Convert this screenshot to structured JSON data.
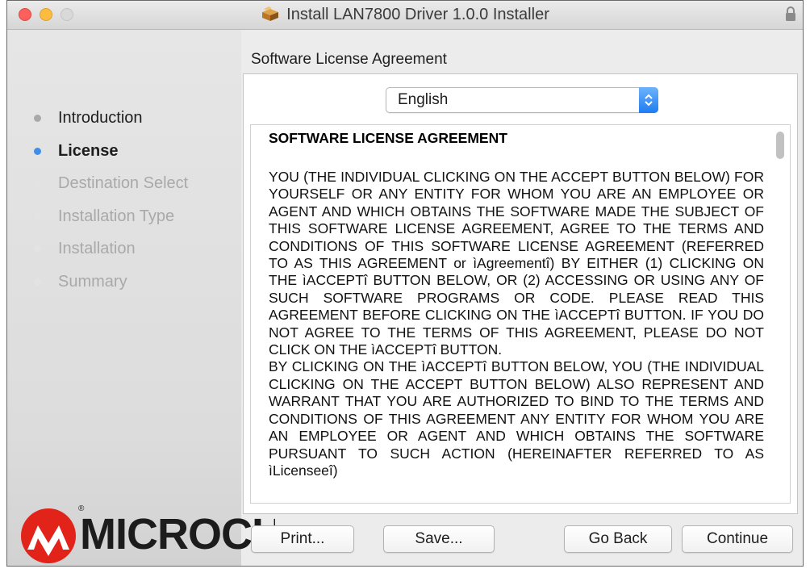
{
  "window": {
    "title": "Install LAN7800 Driver 1.0.0 Installer"
  },
  "sidebar": {
    "steps": [
      {
        "label": "Introduction",
        "state": "done"
      },
      {
        "label": "License",
        "state": "active"
      },
      {
        "label": "Destination Select",
        "state": "pending"
      },
      {
        "label": "Installation Type",
        "state": "pending"
      },
      {
        "label": "Installation",
        "state": "pending"
      },
      {
        "label": "Summary",
        "state": "pending"
      }
    ],
    "logo_text": "MICROCHIP",
    "logo_reg": "®"
  },
  "main": {
    "section_title": "Software License Agreement",
    "language_select": {
      "value": "English"
    },
    "license": {
      "heading": "SOFTWARE LICENSE AGREEMENT",
      "paragraphs": [
        "YOU (THE INDIVIDUAL CLICKING ON THE ACCEPT BUTTON BELOW) FOR YOURSELF OR ANY ENTITY FOR WHOM YOU ARE AN EMPLOYEE OR AGENT AND WHICH OBTAINS THE SOFTWARE MADE THE SUBJECT OF THIS SOFTWARE LICENSE AGREEMENT, AGREE TO THE TERMS AND CONDITIONS OF THIS SOFTWARE LICENSE AGREEMENT (REFERRED TO AS THIS AGREEMENT or ìAgreementî) BY EITHER (1) CLICKING ON THE ìACCEPTî BUTTON BELOW, OR (2) ACCESSING OR USING ANY OF SUCH SOFTWARE PROGRAMS OR CODE. PLEASE READ THIS AGREEMENT BEFORE CLICKING ON THE ìACCEPTî BUTTON. IF YOU DO NOT AGREE TO THE TERMS OF THIS AGREEMENT, PLEASE DO NOT CLICK ON THE ìACCEPTî BUTTON.",
        "BY CLICKING ON THE ìACCEPTî BUTTON BELOW, YOU (THE INDIVIDUAL CLICKING ON THE ACCEPT BUTTON BELOW) ALSO REPRESENT AND WARRANT THAT YOU ARE AUTHORIZED TO BIND TO THE TERMS AND CONDITIONS OF THIS AGREEMENT ANY ENTITY FOR WHOM YOU ARE AN EMPLOYEE OR AGENT AND WHICH OBTAINS THE SOFTWARE PURSUANT TO SUCH ACTION (HEREINAFTER REFERRED TO AS ìLicenseeî)"
      ]
    }
  },
  "buttons": {
    "print": "Print...",
    "save": "Save...",
    "go_back": "Go Back",
    "continue": "Continue"
  },
  "colors": {
    "active_step": "#3f8ee9",
    "close": "#fc605c",
    "minimize": "#fdbc40",
    "logo_red": "#e2231a"
  },
  "icons": [
    "close-icon",
    "minimize-icon",
    "zoom-icon",
    "package-icon",
    "lock-icon",
    "select-arrows-icon",
    "microchip-logo-icon"
  ]
}
